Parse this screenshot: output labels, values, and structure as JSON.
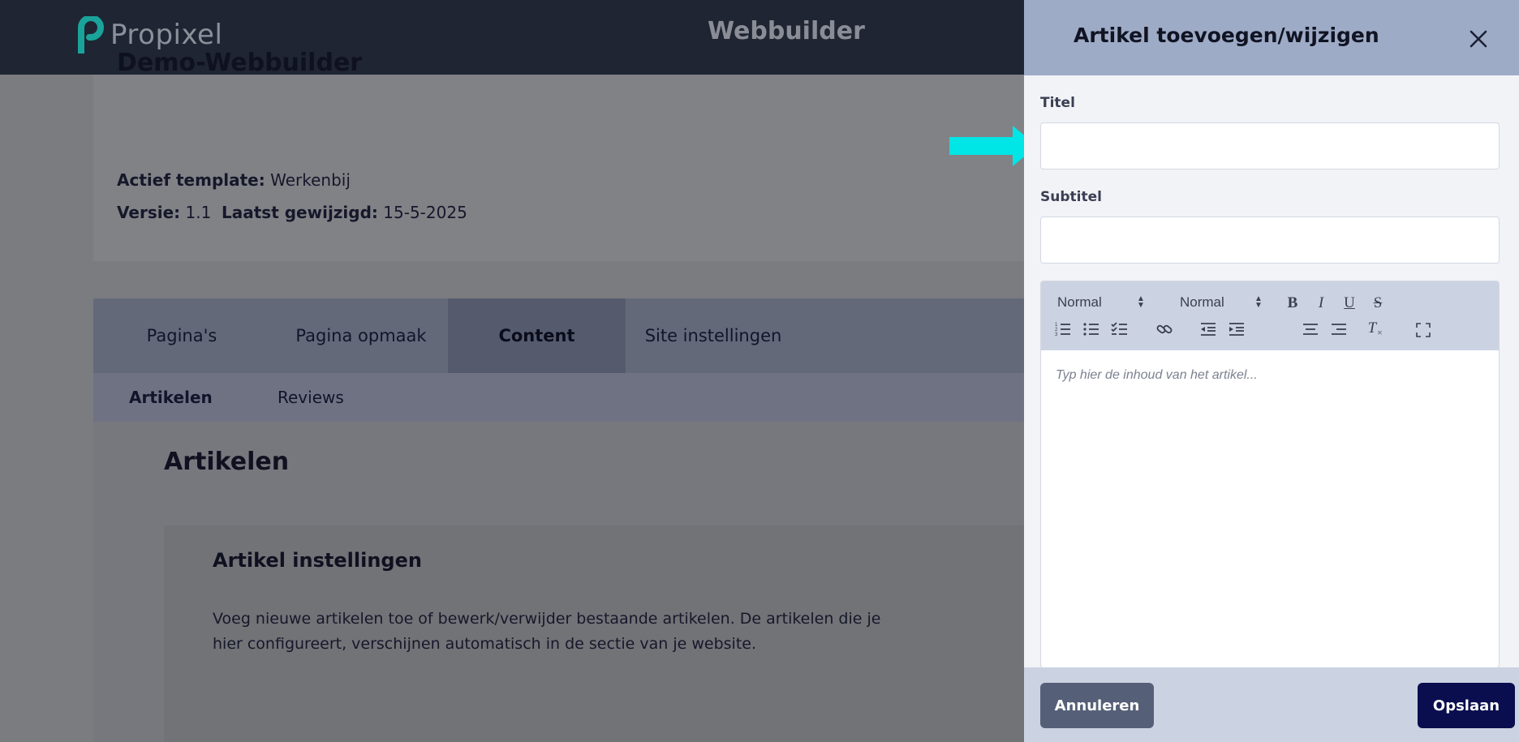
{
  "header": {
    "logo_text": "Propixel",
    "app_title": "Webbuilder"
  },
  "project": {
    "name": "Demo-Webbuilder",
    "template_label": "Actief template:",
    "template_value": "Werkenbij",
    "version_label": "Versie:",
    "version_value": "1.1",
    "modified_label": "Laatst gewijzigd:",
    "modified_value": "15-5-2025"
  },
  "tabs": [
    {
      "label": "Pagina's"
    },
    {
      "label": "Pagina opmaak"
    },
    {
      "label": "Content",
      "active": true
    },
    {
      "label": "Site instellingen"
    }
  ],
  "subtabs": [
    {
      "label": "Artikelen",
      "active": true
    },
    {
      "label": "Reviews"
    }
  ],
  "main": {
    "section_title": "Artikelen",
    "settings_title": "Artikel instellingen",
    "settings_description": "Voeg nieuwe artikelen toe of bewerk/verwijder bestaande artikelen. De artikelen die je hier configureert, verschijnen automatisch in de sectie van je website."
  },
  "panel": {
    "title": "Artikel toevoegen/wijzigen",
    "title_field_label": "Titel",
    "title_field_value": "",
    "subtitle_field_label": "Subtitel",
    "subtitle_field_value": "",
    "editor": {
      "format_select": "Normal",
      "size_select": "Normal",
      "placeholder": "Typ hier de inhoud van het artikel...",
      "bold": "B",
      "italic": "I",
      "underline": "U",
      "strike": "S",
      "clean": "T"
    },
    "cancel_label": "Annuleren",
    "save_label": "Opslaan"
  },
  "colors": {
    "topbar": "#1f2533",
    "panel_header": "#9eabc6",
    "brand_teal": "#1aa39a",
    "arrow": "#00e5e5",
    "save_button": "#0a0e4f",
    "cancel_button": "#556078"
  }
}
